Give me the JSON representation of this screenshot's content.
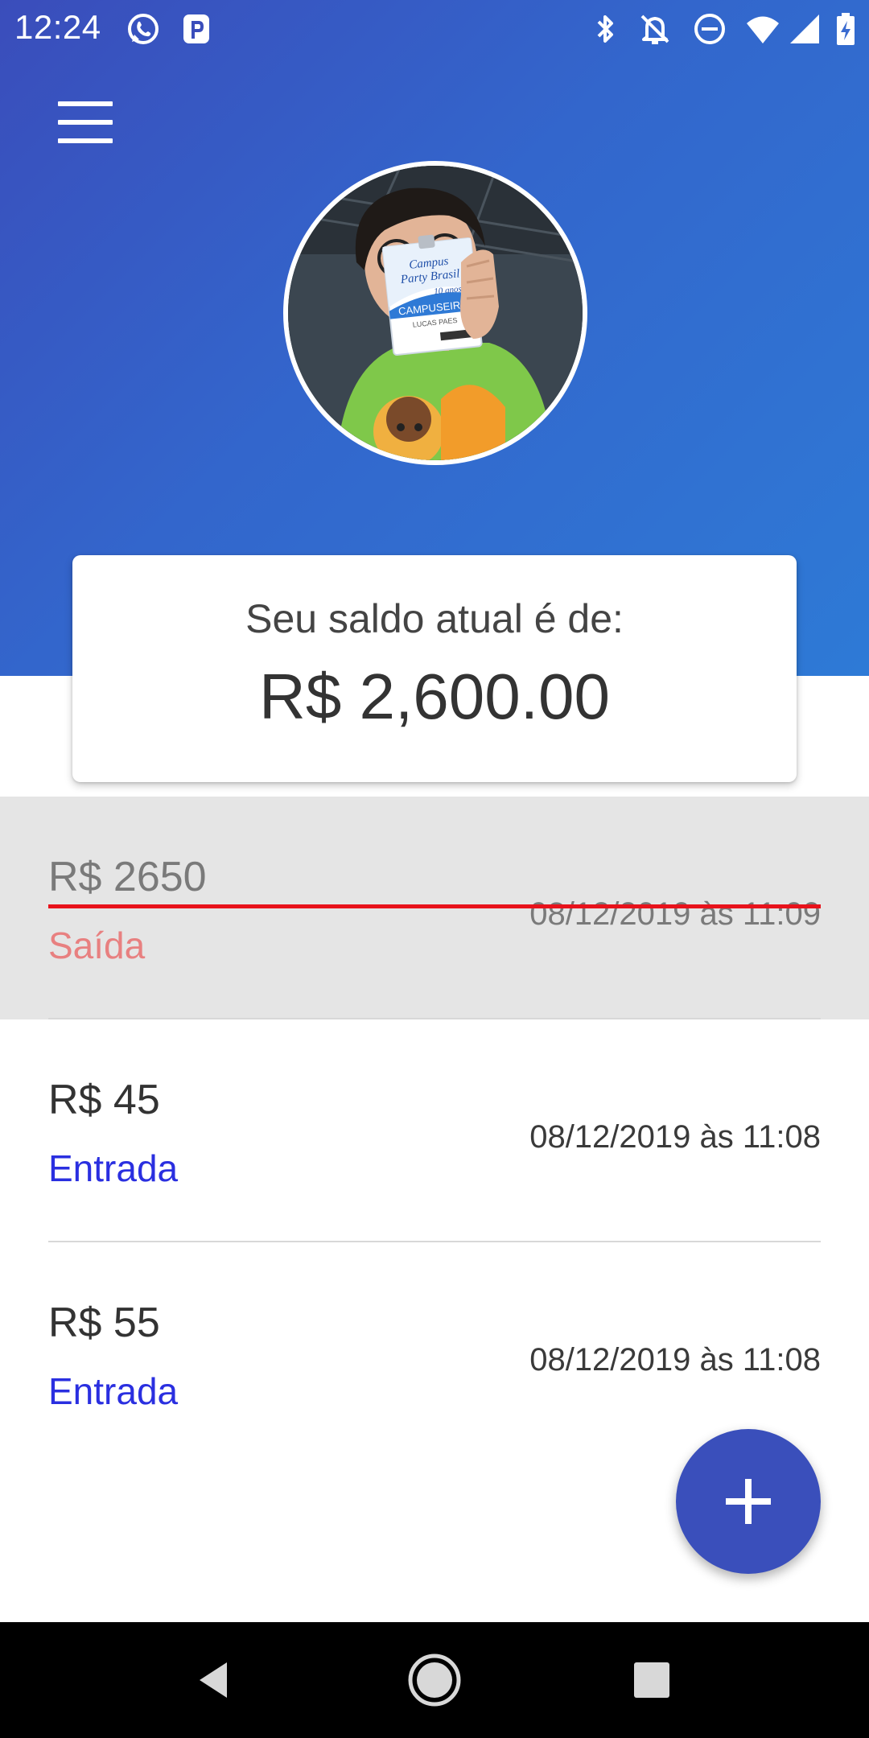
{
  "status_bar": {
    "time": "12:24",
    "icons": [
      "whatsapp-icon",
      "p-app-icon",
      "bluetooth-icon",
      "notifications-off-icon",
      "do-not-disturb-icon",
      "wifi-icon",
      "signal-icon",
      "battery-charging-icon"
    ]
  },
  "header": {
    "menu_icon": "hamburger-menu-icon",
    "avatar_icon": "profile-photo",
    "badge_text": [
      "Campus Party Brasil",
      "10 anos",
      "CAMPUSEIRO",
      "LUCAS PAES"
    ]
  },
  "balance": {
    "label": "Seu saldo atual é de:",
    "value": "R$ 2,600.00"
  },
  "transactions": [
    {
      "amount": "R$ 2650",
      "type": "Saída",
      "date": "08/12/2019 às 11:09",
      "type_color": "#e88080",
      "selected": true,
      "struck": true
    },
    {
      "amount": "R$ 45",
      "type": "Entrada",
      "date": "08/12/2019 às 11:08",
      "type_color": "#2a2fe0",
      "selected": false,
      "struck": false
    },
    {
      "amount": "R$ 55",
      "type": "Entrada",
      "date": "08/12/2019 às 11:08",
      "type_color": "#2a2fe0",
      "selected": false,
      "struck": false
    }
  ],
  "fab": {
    "icon": "plus-icon"
  },
  "nav_bar": {
    "icons": [
      "back-icon",
      "home-icon",
      "recents-icon"
    ]
  },
  "colors": {
    "header_start": "#3a4dbb",
    "header_end": "#2e7ad6",
    "fab": "#3a4fbb",
    "strike": "#e8121b",
    "selected_row": "#e5e5e5"
  }
}
